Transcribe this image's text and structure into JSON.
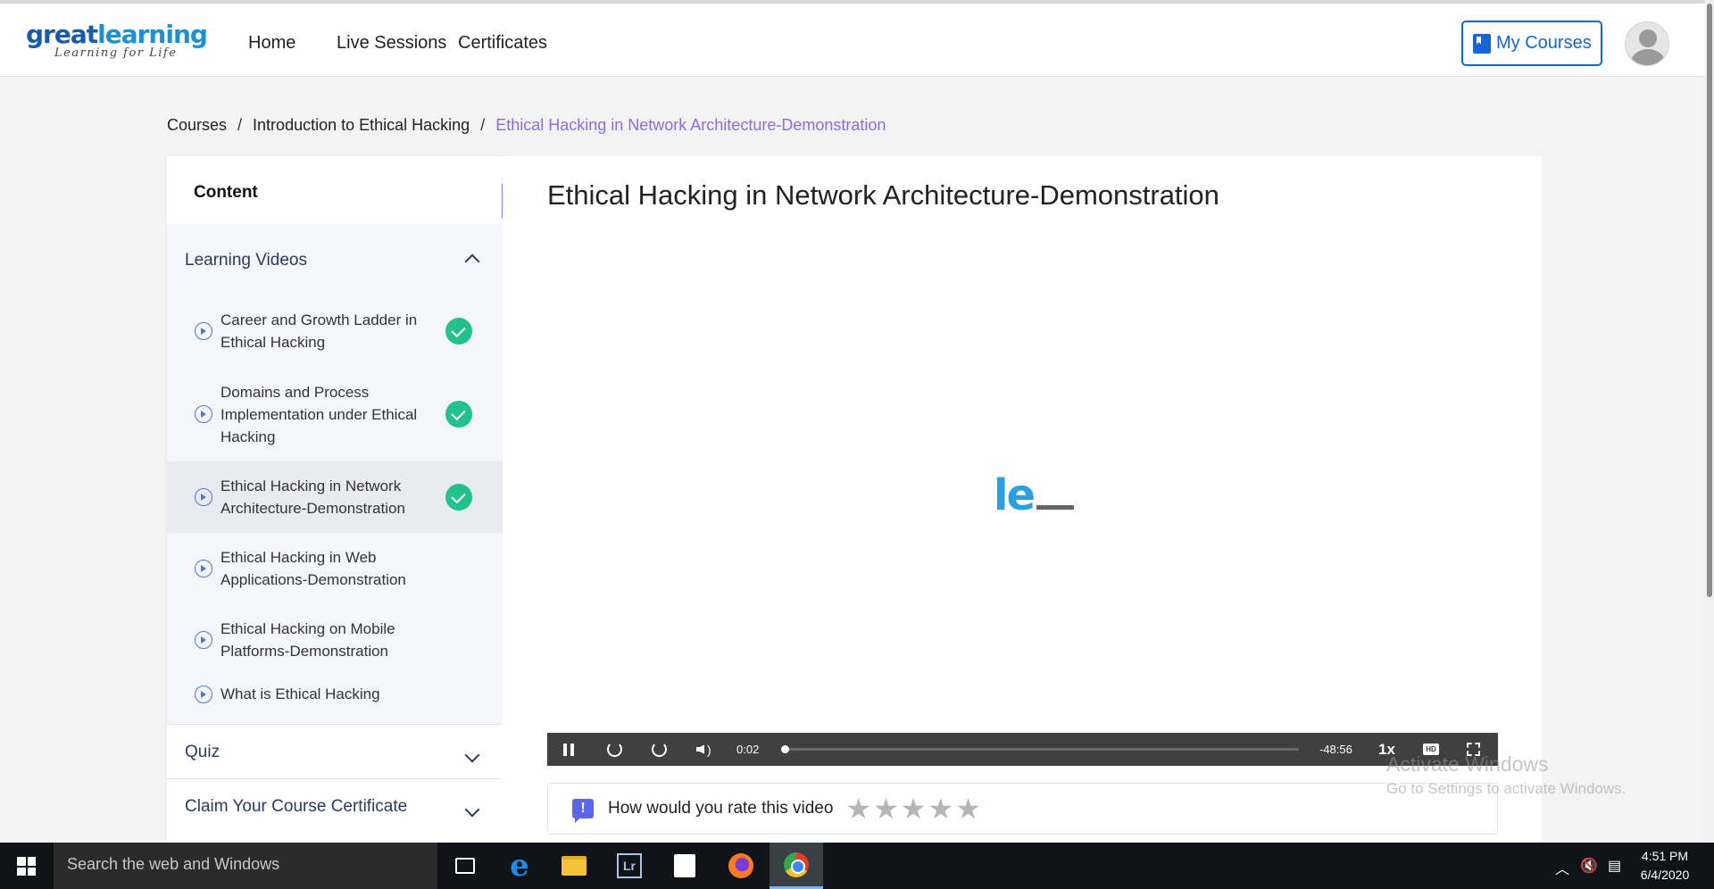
{
  "logo": {
    "brand_part1": "great",
    "brand_part2": "learning",
    "tagline": "Learning for Life"
  },
  "nav": {
    "home": "Home",
    "live_sessions": "Live Sessions",
    "certificates": "Certificates",
    "my_courses": "My Courses"
  },
  "breadcrumb": {
    "root": "Courses",
    "course": "Introduction to Ethical Hacking",
    "current": "Ethical Hacking in Network Architecture-Demonstration",
    "separator": "/"
  },
  "sidebar": {
    "header": "Content",
    "sections": [
      {
        "title": "Learning Videos",
        "expanded": true
      },
      {
        "title": "Quiz",
        "expanded": false
      },
      {
        "title": "Claim Your Course Certificate",
        "expanded": false
      }
    ],
    "videos": [
      {
        "title": "Career and Growth Ladder in Ethical Hacking",
        "completed": true,
        "active": false
      },
      {
        "title": "Domains and Process Implementation under Ethical Hacking",
        "completed": true,
        "active": false
      },
      {
        "title": "Ethical Hacking in Network Architecture-Demonstration",
        "completed": true,
        "active": true
      },
      {
        "title": "Ethical Hacking in Web Applications-Demonstration",
        "completed": false,
        "active": false
      },
      {
        "title": "Ethical Hacking on Mobile Platforms-Demonstration",
        "completed": false,
        "active": false
      },
      {
        "title": "What is Ethical Hacking",
        "completed": false,
        "active": false
      }
    ],
    "collapse_glyph": "«"
  },
  "main": {
    "title": "Ethical Hacking in Network Architecture-Demonstration",
    "loader_text": "le",
    "player": {
      "elapsed": "0:02",
      "remaining": "-48:56",
      "speed": "1x",
      "hd_label": "HD",
      "progress": 0.0
    },
    "rating": {
      "icon_glyph": "!",
      "prompt": "How would you rate this video",
      "stars": 5,
      "selected": 0
    }
  },
  "watermark": {
    "line1": "Activate Windows",
    "line2": "Go to Settings to activate Windows."
  },
  "taskbar": {
    "search_placeholder": "Search the web and Windows",
    "time": "4:51 PM",
    "date": "6/4/2020",
    "lr_label": "Lr"
  },
  "colors": {
    "accent_blue": "#1565d8",
    "breadcrumb_active": "#8a6de0",
    "check_green": "#23c28c",
    "collapse_btn": "#7a86f0"
  }
}
